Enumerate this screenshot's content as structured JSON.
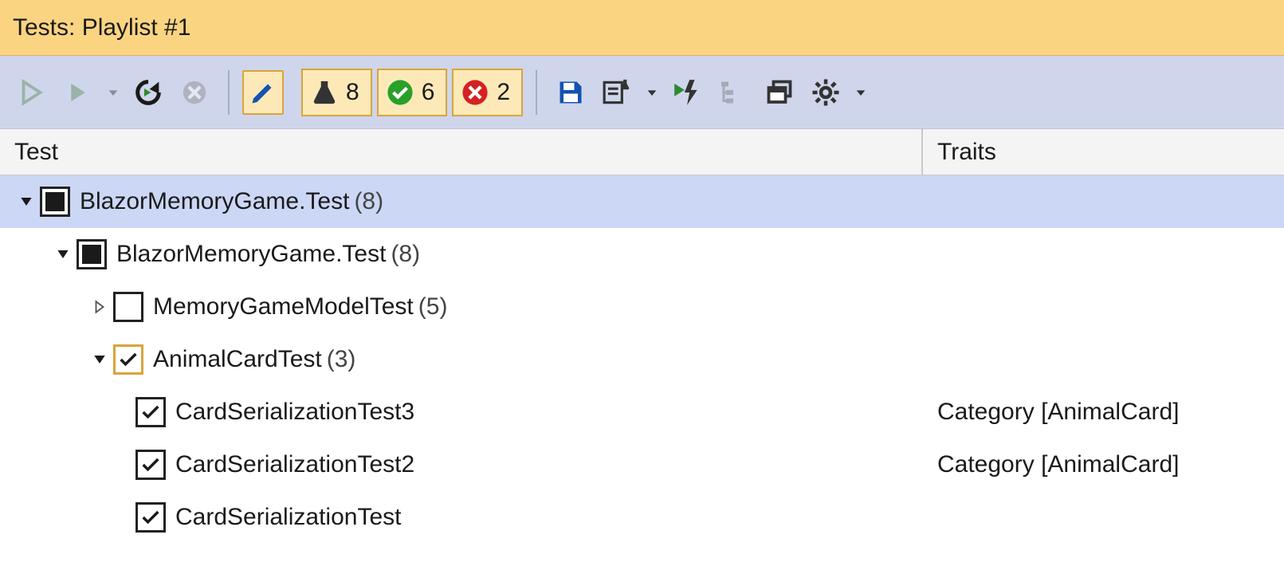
{
  "title": "Tests: Playlist #1",
  "counters": {
    "total": "8",
    "passed": "6",
    "failed": "2"
  },
  "columns": {
    "test": "Test",
    "traits": "Traits"
  },
  "tree": {
    "root": {
      "label": "BlazorMemoryGame.Test",
      "count": "(8)",
      "child": {
        "label": "BlazorMemoryGame.Test",
        "count": "(8)",
        "groups": [
          {
            "label": "MemoryGameModelTest",
            "count": "(5)"
          },
          {
            "label": "AnimalCardTest",
            "count": "(3)",
            "tests": [
              {
                "label": "CardSerializationTest3",
                "trait": "Category [AnimalCard]"
              },
              {
                "label": "CardSerializationTest2",
                "trait": "Category [AnimalCard]"
              },
              {
                "label": "CardSerializationTest",
                "trait": ""
              }
            ]
          }
        ]
      }
    }
  }
}
